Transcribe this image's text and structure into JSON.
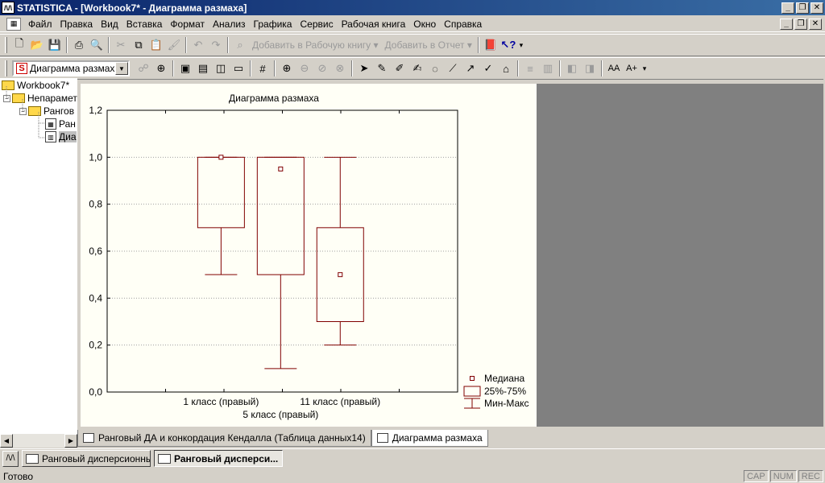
{
  "window": {
    "title": "STATISTICA - [Workbook7* - Диаграмма размаха]",
    "app_icon": "statistica-icon",
    "controls": [
      "_",
      "❐",
      "✕"
    ]
  },
  "menu": {
    "items": [
      "Файл",
      "Правка",
      "Вид",
      "Вставка",
      "Формат",
      "Анализ",
      "Графика",
      "Сервис",
      "Рабочая книга",
      "Окно",
      "Справка"
    ]
  },
  "toolbar1": {
    "add_to_workbook": "Добавить в Рабочую книгу",
    "add_to_report": "Добавить в Отчет"
  },
  "toolbar2": {
    "graph_selector": "Диаграмма размах..."
  },
  "tree": {
    "nodes": [
      {
        "label": "Workbook7*"
      },
      {
        "label": "Непарамет"
      },
      {
        "label": "Рангов"
      },
      {
        "label": "Ран"
      },
      {
        "label": "Диа"
      }
    ]
  },
  "chart_data": {
    "type": "boxplot",
    "title": "Диаграмма размаха",
    "categories": [
      "1 класс (правый)",
      "5 класс (правый)",
      "11 класс (правый)"
    ],
    "boxes": [
      {
        "name": "1 класс (правый)",
        "median": 1.0,
        "q1": 0.7,
        "q3": 1.0,
        "min": 0.5,
        "max": 1.0
      },
      {
        "name": "5 класс (правый)",
        "median": 0.95,
        "q1": 0.5,
        "q3": 1.0,
        "min": 0.1,
        "max": 1.0
      },
      {
        "name": "11 класс (правый)",
        "median": 0.5,
        "q1": 0.3,
        "q3": 0.7,
        "min": 0.2,
        "max": 1.0
      }
    ],
    "ylim": [
      0,
      1.2
    ],
    "yticks": [
      "0,0",
      "0,2",
      "0,4",
      "0,6",
      "0,8",
      "1,0",
      "1,2"
    ],
    "grid": true,
    "legend": {
      "placement": "bottom-right",
      "entries": [
        "Медиана",
        "25%-75%",
        "Мин-Макс"
      ]
    },
    "color": "#800000"
  },
  "sheet_tabs": [
    {
      "label": "Ранговый ДА и конкордация Кендалла (Таблица данных14)"
    },
    {
      "label": "Диаграмма размаха"
    }
  ],
  "windows_strip": [
    {
      "label": "Ранговый дисперсионны..."
    },
    {
      "label": "Ранговый дисперси..."
    }
  ],
  "status": {
    "text": "Готово",
    "indicators": [
      "CAP",
      "NUM",
      "REC"
    ]
  }
}
